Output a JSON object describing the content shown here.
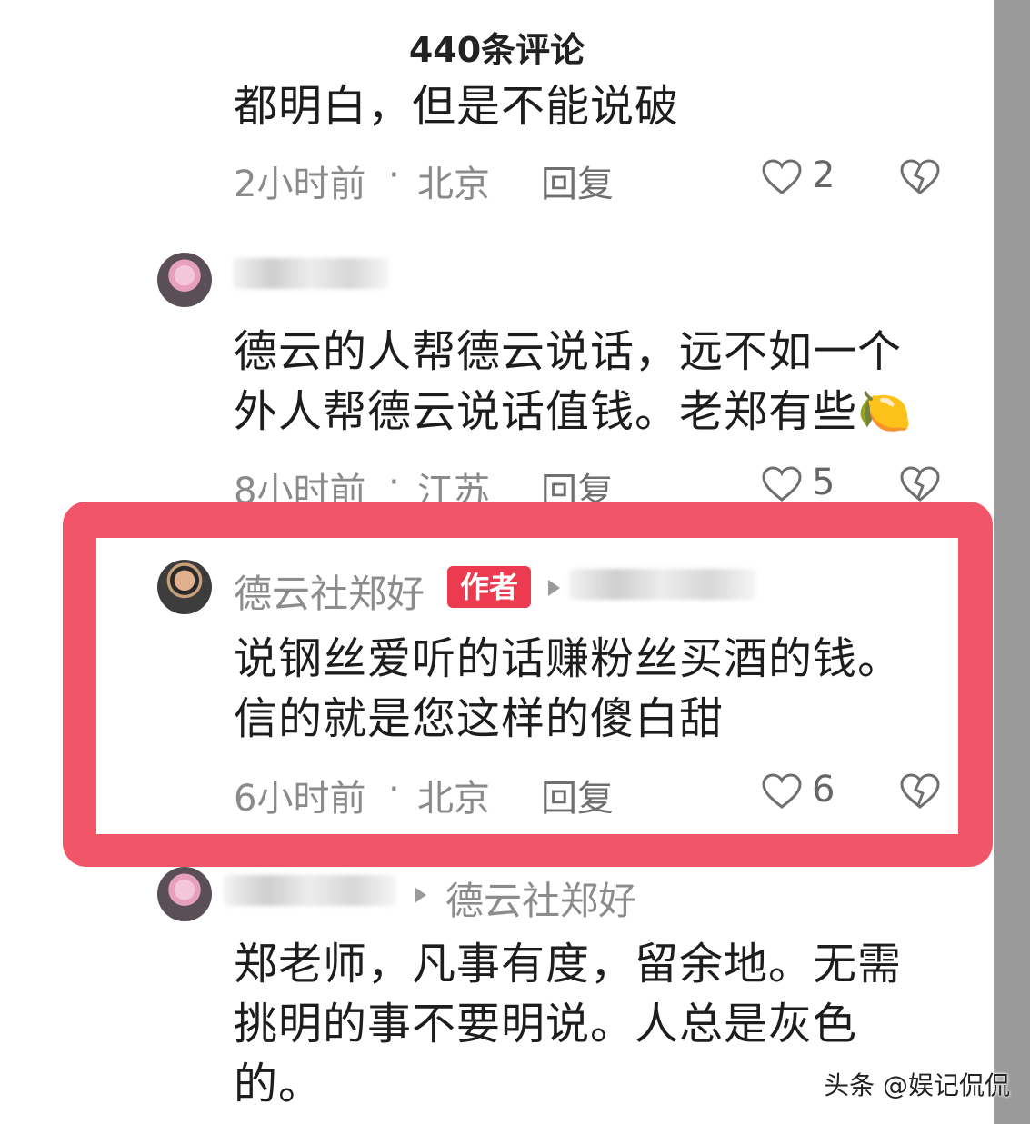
{
  "header": {
    "title": "440条评论"
  },
  "comments": [
    {
      "text": [
        "都明白，但是不能说破"
      ],
      "time": "2小时前",
      "dot": "·",
      "location": "北京",
      "reply_label": "回复",
      "likes": "2"
    },
    {
      "text": [
        "德云的人帮德云说话，远不如一个",
        "外人帮德云说话值钱。老郑有些🍋"
      ],
      "time": "8小时前",
      "dot": "·",
      "location": "江苏",
      "reply_label": "回复",
      "likes": "5"
    },
    {
      "author": "德云社郑好",
      "badge": "作者",
      "text": [
        "说钢丝爱听的话赚粉丝买酒的钱。",
        "信的就是您这样的傻白甜"
      ],
      "time": "6小时前",
      "dot": "·",
      "location": "北京",
      "reply_label": "回复",
      "likes": "6"
    },
    {
      "reply_to": "德云社郑好",
      "text": [
        "郑老师，凡事有度，留余地。无需",
        "挑明的事不要明说。人总是灰色",
        "的。"
      ]
    }
  ],
  "watermark": "头条 @娱记侃侃",
  "colors": {
    "highlight": "#f25567",
    "author_badge": "#ec3b4e",
    "meta_text": "#8a8a8a"
  },
  "icons": {
    "like": "heart-outline-icon",
    "dislike": "broken-heart-icon",
    "reply_arrow": "play-arrow-icon"
  }
}
